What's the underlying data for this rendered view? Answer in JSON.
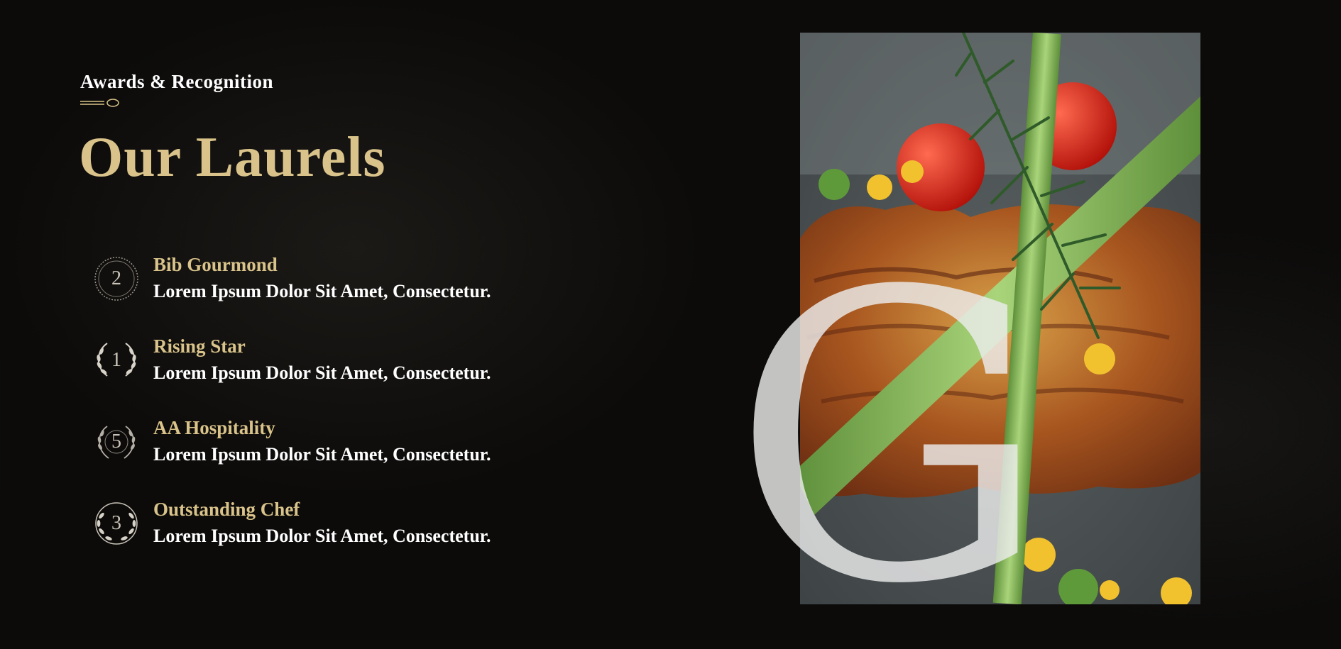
{
  "section": {
    "subtitle": "Awards & Recognition",
    "heading": "Our Laurels",
    "decorative_letter": "G"
  },
  "awards": [
    {
      "number": "2",
      "title": "Bib Gourmond",
      "text": "Lorem Ipsum Dolor Sit Amet, Consectetur.",
      "icon": "award-badge-icon"
    },
    {
      "number": "1",
      "title": "Rising Star",
      "text": "Lorem Ipsum Dolor Sit Amet, Consectetur.",
      "icon": "laurel-wreath-icon"
    },
    {
      "number": "5",
      "title": "AA Hospitality",
      "text": "Lorem Ipsum Dolor Sit Amet, Consectetur.",
      "icon": "laurel-wreath-icon"
    },
    {
      "number": "3",
      "title": "Outstanding Chef",
      "text": "Lorem Ipsum Dolor Sit Amet, Consectetur.",
      "icon": "laurel-wreath-icon"
    }
  ],
  "colors": {
    "background": "#0c0b0a",
    "accent_gold": "#d9c38a",
    "text_white": "#ffffff"
  }
}
